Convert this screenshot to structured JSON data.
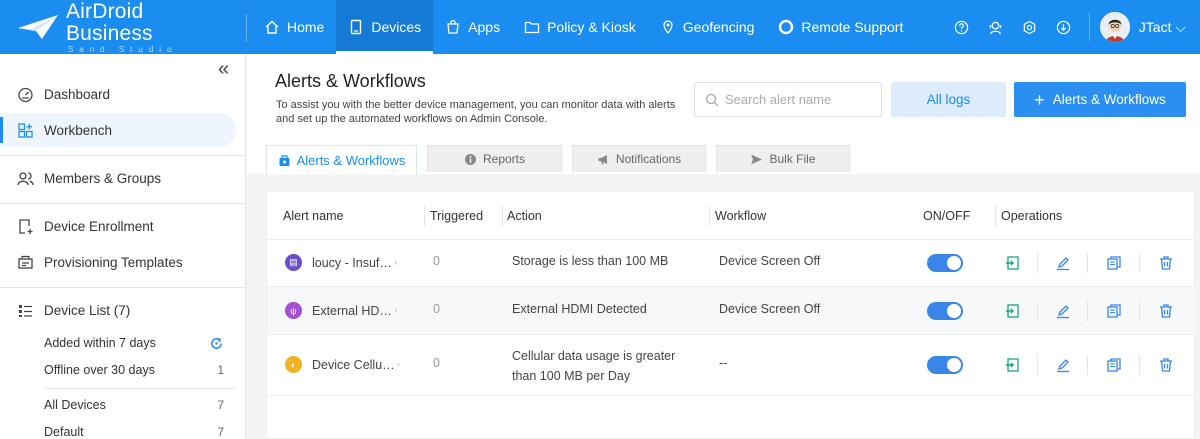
{
  "brand": {
    "name": "AirDroid Business",
    "tagline": "Sand Studio"
  },
  "nav": {
    "items": [
      {
        "label": "Home",
        "icon": "home-icon"
      },
      {
        "label": "Devices",
        "icon": "device-icon",
        "active": true
      },
      {
        "label": "Apps",
        "icon": "apps-icon"
      },
      {
        "label": "Policy & Kiosk",
        "icon": "folder-icon"
      },
      {
        "label": "Geofencing",
        "icon": "geofence-icon"
      },
      {
        "label": "Remote Support",
        "icon": "lifebuoy-icon"
      }
    ],
    "right_icons": [
      "help-icon",
      "agent-icon",
      "settings-icon",
      "download-icon"
    ],
    "user": {
      "name": "JTact"
    }
  },
  "sidebar": {
    "items": [
      {
        "label": "Dashboard",
        "icon": "dashboard-icon"
      },
      {
        "label": "Workbench",
        "icon": "workbench-icon",
        "active": true
      },
      {
        "label": "Members & Groups",
        "icon": "members-icon"
      },
      {
        "label": "Device Enrollment",
        "icon": "enrollment-icon"
      },
      {
        "label": "Provisioning Templates",
        "icon": "templates-icon"
      },
      {
        "label": "Device List (7)",
        "icon": "list-icon"
      }
    ],
    "sub_items": [
      {
        "label": "Added within 7 days",
        "count": ""
      },
      {
        "label": "Offline over 30 days",
        "count": "1"
      },
      {
        "label": "All Devices",
        "count": "7"
      },
      {
        "label": "Default",
        "count": "7"
      }
    ]
  },
  "page": {
    "title": "Alerts & Workflows",
    "description": "To assist you with the better device management, you can monitor data with alerts and set up the automated workflows on Admin Console.",
    "search_placeholder": "Search alert name",
    "all_logs_label": "All logs",
    "add_label": "Alerts & Workflows"
  },
  "tabs": [
    {
      "label": "Alerts & Workflows",
      "icon": "alert-bell-icon",
      "active": true
    },
    {
      "label": "Reports",
      "icon": "info-icon"
    },
    {
      "label": "Notifications",
      "icon": "megaphone-icon"
    },
    {
      "label": "Bulk File",
      "icon": "send-icon"
    }
  ],
  "table": {
    "columns": [
      "Alert name",
      "Triggered",
      "Action",
      "Workflow",
      "ON/OFF",
      "Operations"
    ],
    "rows": [
      {
        "name": "loucy - Insuf…",
        "icon_color": "#6b4fc8",
        "icon": "storage-icon",
        "triggered": "0",
        "action": "Storage is less than 100 MB",
        "action2": "",
        "workflow": "Device Screen Off",
        "enabled": true
      },
      {
        "name": "External HD…",
        "icon_color": "#a24fd0",
        "icon": "usb-icon",
        "triggered": "0",
        "action": "External HDMI Detected",
        "action2": "",
        "workflow": "Device Screen Off",
        "enabled": true
      },
      {
        "name": "Device Cellu…",
        "icon_color": "#f0b323",
        "icon": "cellular-icon",
        "triggered": "0",
        "action": "Cellular data usage is greater",
        "action2": "than 100 MB per Day",
        "workflow": "--",
        "enabled": true
      }
    ]
  },
  "colors": {
    "primary": "#1b8df0",
    "toggle_on": "#3a86e8",
    "op_green": "#1aa67a",
    "op_blue": "#3a86e8"
  }
}
